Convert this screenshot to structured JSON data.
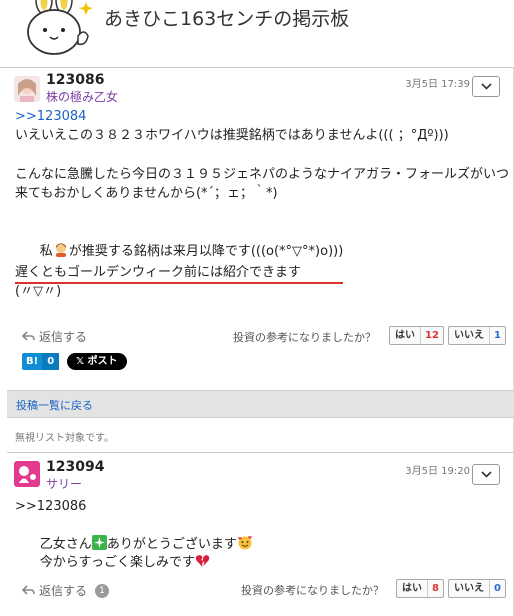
{
  "header": {
    "title": "あきひこ163センチの掲示板"
  },
  "posts": [
    {
      "id": "123086",
      "user": "株の極み乙女",
      "date": "3月5日 17:39",
      "reply_to": ">>123084",
      "lines": {
        "l1": "いえいえこの３８２３ホワイハウは推奨銘柄ではありませんよ((( ；°Дº)))",
        "l2": "こんなに急騰したら今日の３１９５ジェネパのようなナイアガラ・フォールズがいつ",
        "l3": "来てもおかしくありませんから(*´；ェ；｀*)",
        "l4a": "私",
        "l4b": "が推奨する銘柄は来月以降です(((o(*°▽°*)o)))",
        "l5": "遅くともゴールデンウィーク前には紹介できます",
        "l6": "(〃▽〃)"
      },
      "reply_label": "返信する",
      "vote_question": "投資の参考になりましたか？",
      "yes_label": "はい",
      "yes_count": "12",
      "no_label": "いいえ",
      "no_count": "1",
      "share_b_label": "B!",
      "share_b_count": "0",
      "share_x_label": "𝕏 ポスト"
    },
    {
      "id": "123094",
      "user": "サリー",
      "date": "3月5日 19:20",
      "reply_to": ">>123086",
      "lines": {
        "l1a": "乙女さん",
        "l1b": "ありがとうございます",
        "l2a": "今からすっごく楽しみです"
      },
      "reply_label": "返信する",
      "reply_count": "1",
      "vote_question": "投資の参考になりましたか？",
      "yes_label": "はい",
      "yes_count": "8",
      "no_label": "いいえ",
      "no_count": "0"
    }
  ],
  "back_to_list": "投稿一覧に戻る",
  "ignore_note": "無視リスト対象です。"
}
